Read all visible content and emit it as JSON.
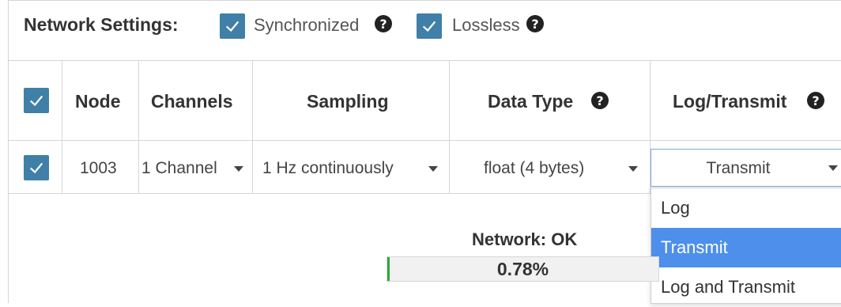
{
  "network_settings": {
    "title": "Network Settings:",
    "synchronized": {
      "label": "Synchronized",
      "checked": true
    },
    "lossless": {
      "label": "Lossless",
      "checked": true
    }
  },
  "table": {
    "headers": {
      "node": "Node",
      "channels": "Channels",
      "sampling": "Sampling",
      "data_type": "Data Type",
      "log_transmit": "Log/Transmit"
    },
    "rows": [
      {
        "checked": true,
        "node": "1003",
        "channels": "1 Channel",
        "sampling": "1 Hz continuously",
        "data_type": "float (4 bytes)",
        "log_transmit": "Transmit"
      }
    ]
  },
  "log_transmit_dropdown": {
    "options": [
      "Log",
      "Transmit",
      "Log and Transmit"
    ],
    "selected": "Transmit"
  },
  "network_status": {
    "title": "Network: OK",
    "usage_text": "0.78%",
    "usage_percent": 0.78
  },
  "colors": {
    "checkbox": "#3f7fa8",
    "dropdown_selected": "#4d8fea",
    "progress_fill": "#2fa83a"
  }
}
